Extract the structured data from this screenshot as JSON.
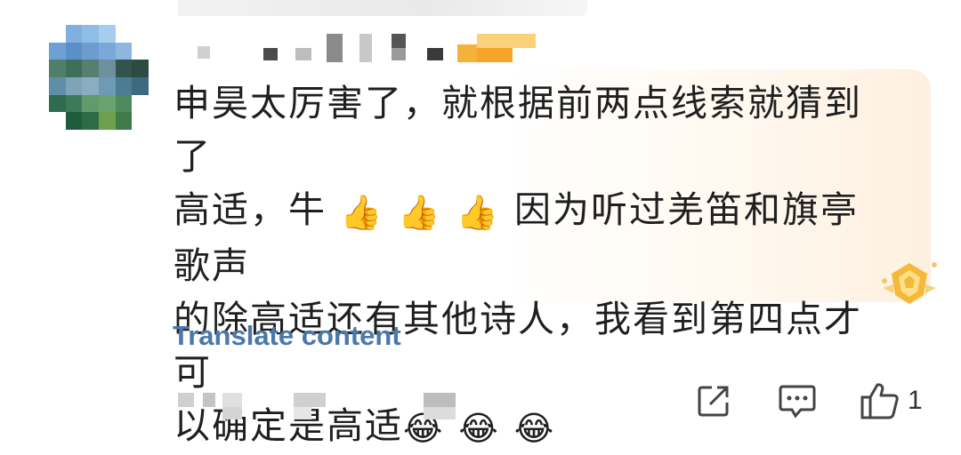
{
  "comment": {
    "line1": "申昊太厉害了，就根据前两点线索就猜到了",
    "line2_start": "高适，牛",
    "line2_end": "因为听过羌笛和旗亭歌声",
    "line3": "的除高适还有其他诗人，我看到第四点才可",
    "line4": "以确定是高适",
    "thumbs_emoji": "👍👍👍",
    "laugh_emoji": "😂😂😂"
  },
  "translate_label": "Translate content",
  "actions": {
    "like_count": "1",
    "icons": [
      "share-icon",
      "comment-icon",
      "like-icon"
    ]
  },
  "colors": {
    "link": "#4b77a9",
    "bubble_accent": "#fdf0e0",
    "badge_gold": "#f5b93a"
  }
}
